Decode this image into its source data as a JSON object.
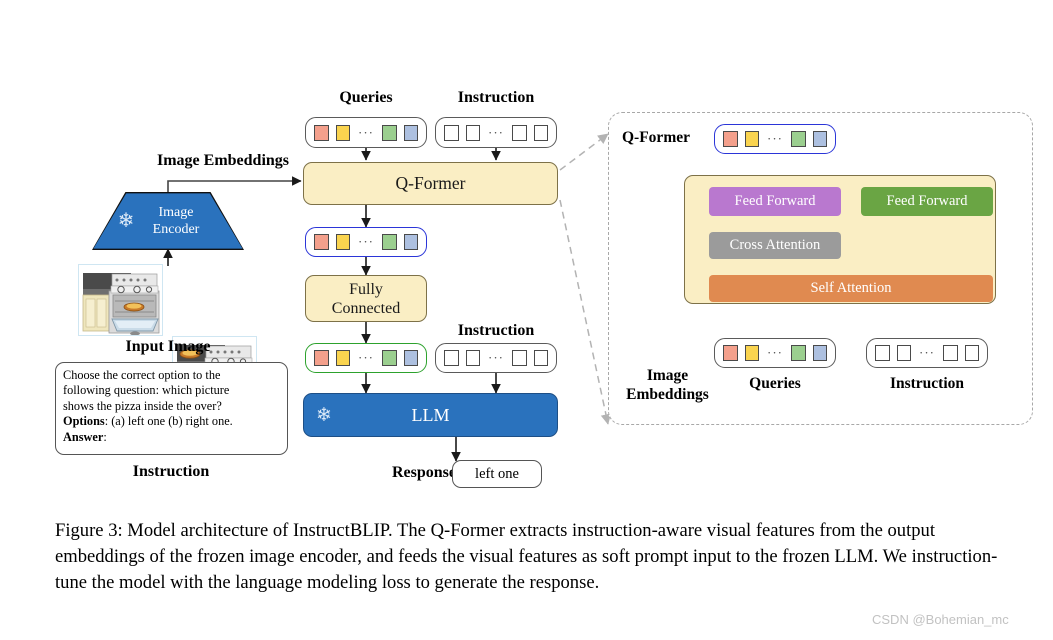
{
  "figure": {
    "caption": "Figure 3: Model architecture of InstructBLIP. The Q-Former extracts instruction-aware visual features from the output embeddings of the frozen image encoder, and feeds the visual features as soft prompt input to the frozen LLM. We instruction-tune the model with the language modeling loss to generate the response.",
    "watermark": "CSDN @Bohemian_mc"
  },
  "left_pipeline": {
    "queries_label": "Queries",
    "instruction_label_top": "Instruction",
    "image_embeddings_label": "Image Embeddings",
    "image_encoder_line1": "Image",
    "image_encoder_line2": "Encoder",
    "input_image_label": "Input Image",
    "qformer_label": "Q-Former",
    "fully_connected_line1": "Fully",
    "fully_connected_line2": "Connected",
    "instruction_label_mid": "Instruction",
    "llm_label": "LLM",
    "response_label": "Response",
    "response_value": "left one",
    "instruction_caption": "Instruction",
    "instruction_text": {
      "line1": "Choose the correct option to the",
      "line2": "following question: which picture",
      "line3": "shows the pizza inside the over?",
      "options_bold": "Options",
      "options_rest": ": (a) left one (b) right one.",
      "answer_bold": "Answer",
      "answer_rest": ":"
    }
  },
  "detail_panel": {
    "title": "Q-Former",
    "feed_forward_left": "Feed Forward",
    "feed_forward_right": "Feed Forward",
    "cross_attention": "Cross Attention",
    "self_attention": "Self Attention",
    "image_embeddings_line1": "Image",
    "image_embeddings_line2": "Embeddings",
    "queries_label": "Queries",
    "instruction_label": "Instruction"
  },
  "colors": {
    "token_1": "#f4a08c",
    "token_2": "#fad44f",
    "token_3": "#9bcf8f",
    "token_4": "#adc0e0",
    "cream_block": "#faeec4",
    "blue_block": "#2a72bd",
    "feed_forward_left": "#b978cf",
    "feed_forward_right": "#6aa544",
    "cross_attention": "#9b9b9b",
    "self_attention": "#e08a50",
    "blue_border": "#2b35d8",
    "green_border": "#2da22d"
  },
  "icons": {
    "snowflake": "❄"
  }
}
